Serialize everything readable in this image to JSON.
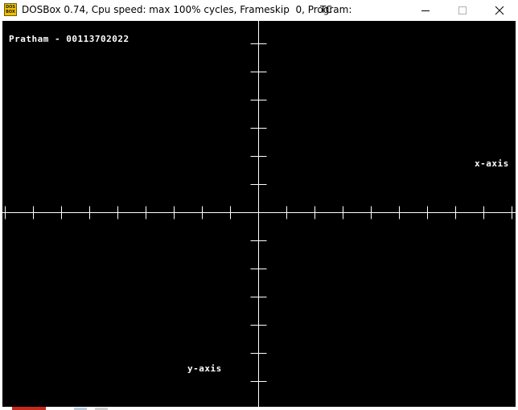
{
  "window": {
    "title": "DOSBox 0.74, Cpu speed: max 100% cycles, Frameskip  0, Program:",
    "program": "TC",
    "icon_text_top": "DOS",
    "icon_text_bottom": "BOX",
    "icons": {
      "app": "dosbox-icon",
      "minimize": "minimize-icon",
      "maximize": "maximize-icon",
      "close": "close-icon"
    }
  },
  "screen": {
    "background": "#000000",
    "foreground": "#ffffff",
    "name_label": "Pratham - 00113702022",
    "x_axis_label": "x-axis",
    "y_axis_label": "y-axis"
  }
}
